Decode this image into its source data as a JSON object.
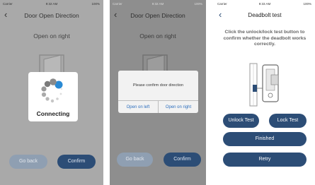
{
  "screen1": {
    "status": {
      "carrier": "Carrier",
      "time": "9:32 AM",
      "battery": "100%"
    },
    "back_icon": "chevron-left-icon",
    "title": "Door Open Direction",
    "heading": "Open on right",
    "loader_label": "Connecting",
    "buttons": {
      "go_back": "Go back",
      "confirm": "Confirm"
    }
  },
  "screen2": {
    "status": {
      "carrier": "Carrier",
      "time": "9:32 AM",
      "battery": "100%"
    },
    "back_icon": "chevron-left-icon",
    "title": "Door Open Direction",
    "heading": "Open on right",
    "dialog": {
      "message": "Please confirm door direction",
      "option_left": "Open on left",
      "option_right": "Open on right"
    },
    "buttons": {
      "go_back": "Go back",
      "confirm": "Confirm"
    }
  },
  "screen3": {
    "status": {
      "carrier": "Carrier",
      "time": "9:33 AM",
      "battery": "100%"
    },
    "back_icon": "chevron-left-icon",
    "title": "Deadbolt test",
    "instruction": "Click the unlock/lock test button to confirm whether the deadbolt works correctly.",
    "buttons": {
      "unlock_test": "Unlock Test",
      "lock_test": "Lock Test",
      "finished": "Finished",
      "retry": "Retry"
    }
  },
  "colors": {
    "primary": "#2c4d76",
    "secondary": "#8f9fb2",
    "dialog_link": "#2e6fbd",
    "spinner_accent": "#2a8ad4"
  }
}
